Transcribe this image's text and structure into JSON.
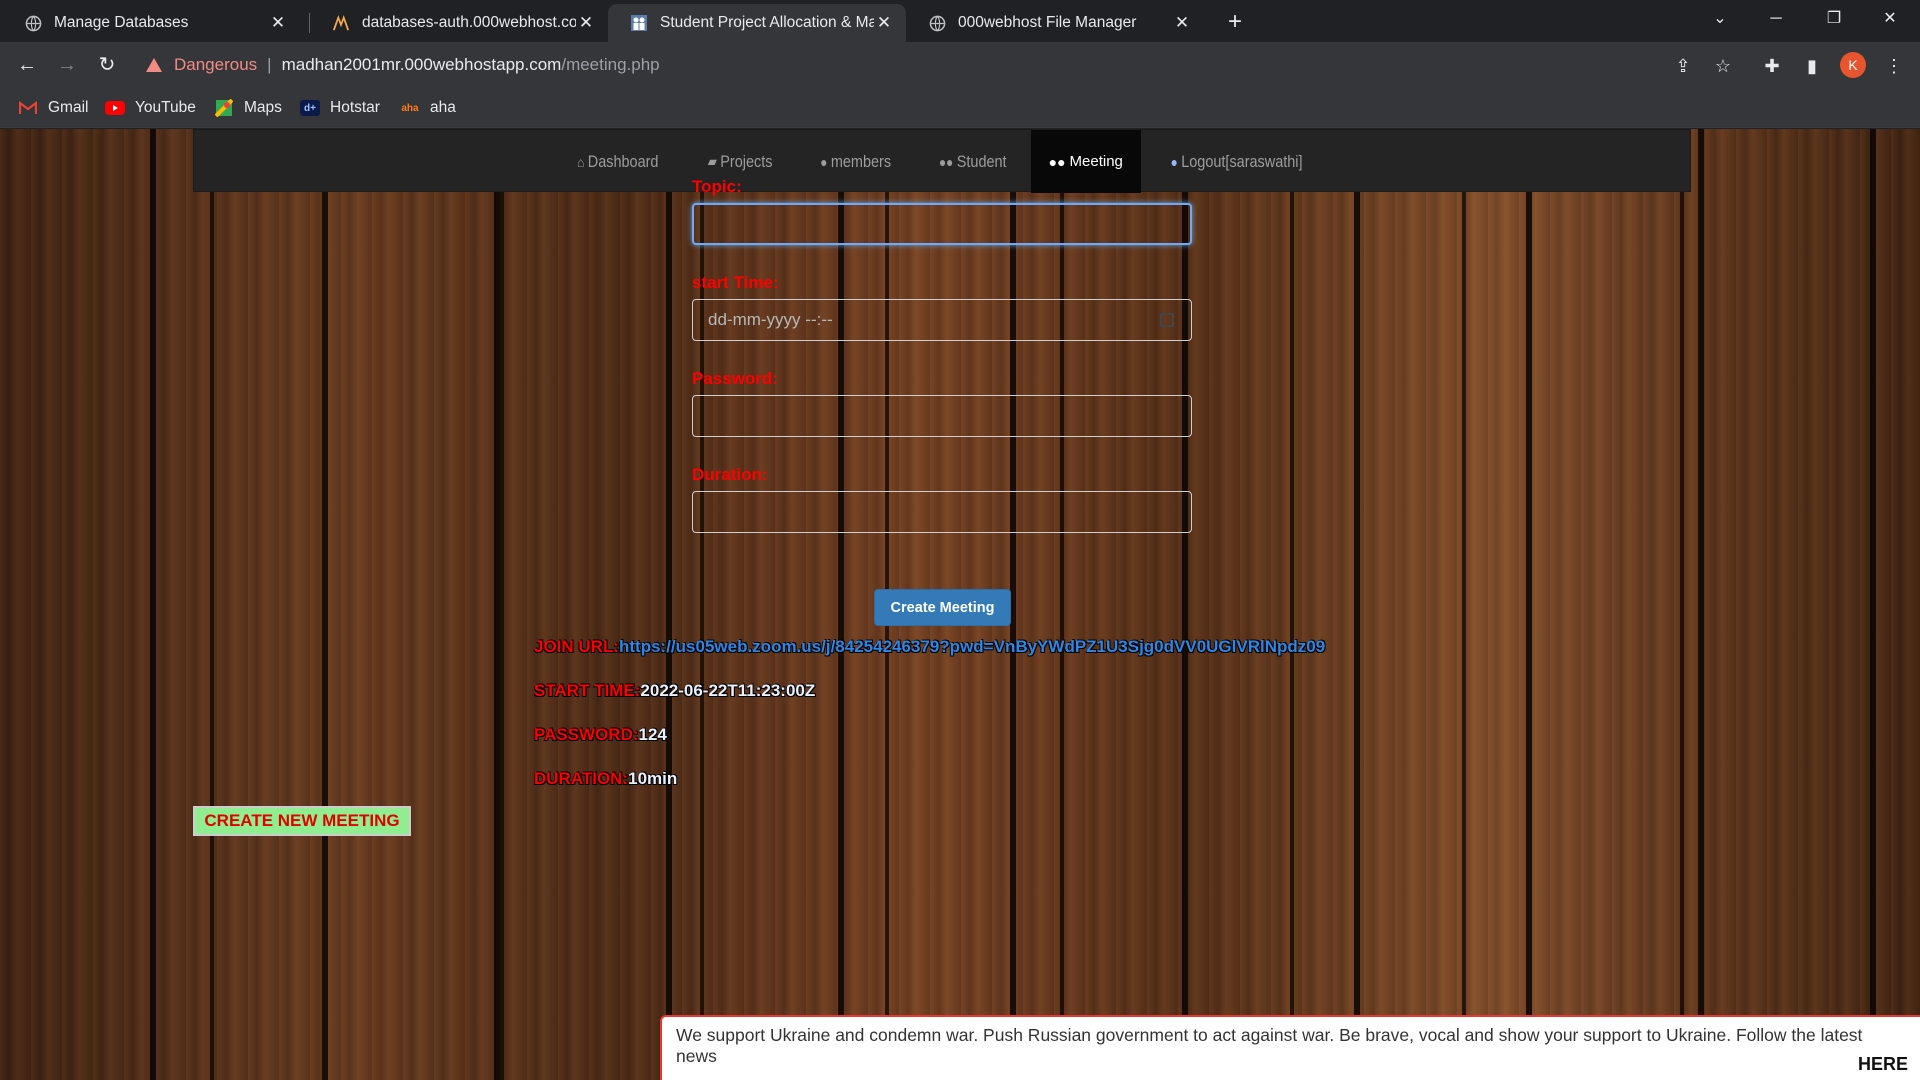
{
  "browser": {
    "tabs": [
      {
        "title": "Manage Databases",
        "icon": "globe-icon"
      },
      {
        "title": "databases-auth.000webhost.com",
        "icon": "000webhost-icon"
      },
      {
        "title": "Student Project Allocation & Man",
        "icon": "students-icon"
      },
      {
        "title": "000webhost File Manager",
        "icon": "globe-icon"
      }
    ],
    "security_label": "Dangerous",
    "url_host": "madhan2001mr.000webhostapp.com",
    "url_path": "/meeting.php",
    "profile_initial": "K",
    "bookmarks": [
      {
        "label": "Gmail",
        "icon": "gmail-icon"
      },
      {
        "label": "YouTube",
        "icon": "youtube-icon"
      },
      {
        "label": "Maps",
        "icon": "maps-icon"
      },
      {
        "label": "Hotstar",
        "icon": "hotstar-icon"
      },
      {
        "label": "aha",
        "icon": "aha-icon"
      }
    ],
    "accent_color": "#e8542d"
  },
  "nav": {
    "items": [
      {
        "label": "Dashboard",
        "icon": "home-icon"
      },
      {
        "label": "Projects",
        "icon": "book-icon"
      },
      {
        "label": "members",
        "icon": "user-icon"
      },
      {
        "label": "Student",
        "icon": "users-icon"
      },
      {
        "label": "Meeting",
        "icon": "users-icon",
        "active": true
      },
      {
        "label": "Logout[saraswathi]",
        "icon": "user-icon"
      }
    ]
  },
  "form": {
    "topic_label": "Topic:",
    "topic_value": "",
    "start_label": "start Time:",
    "start_placeholder": "dd-mm-yyyy --:--",
    "password_label": "Password:",
    "password_value": "",
    "duration_label": "Duration:",
    "duration_value": "",
    "submit_label": "Create Meeting"
  },
  "result": {
    "join_key": "JOIN URL:",
    "join_url": "https://us05web.zoom.us/j/84254246379?pwd=VnByYWdPZ1U3Sjg0dVV0UGlVRlNpdz09",
    "start_key": "START TIME:",
    "start_value": "2022-06-22T11:23:00Z",
    "password_key": "PASSWORD:",
    "password_value": "124",
    "duration_key": "DURATION:",
    "duration_value": "10min"
  },
  "create_new_label": "CREATE NEW MEETING",
  "banner": {
    "text": "We support Ukraine and condemn war. Push Russian government to act against war. Be brave, vocal and show your support to Ukraine. Follow the latest news",
    "link": "HERE"
  },
  "colors": {
    "label_red": "#ff0000",
    "button_blue": "#337ab7",
    "link_blue": "#2e87e8",
    "new_meeting_bg": "#90ee90"
  }
}
